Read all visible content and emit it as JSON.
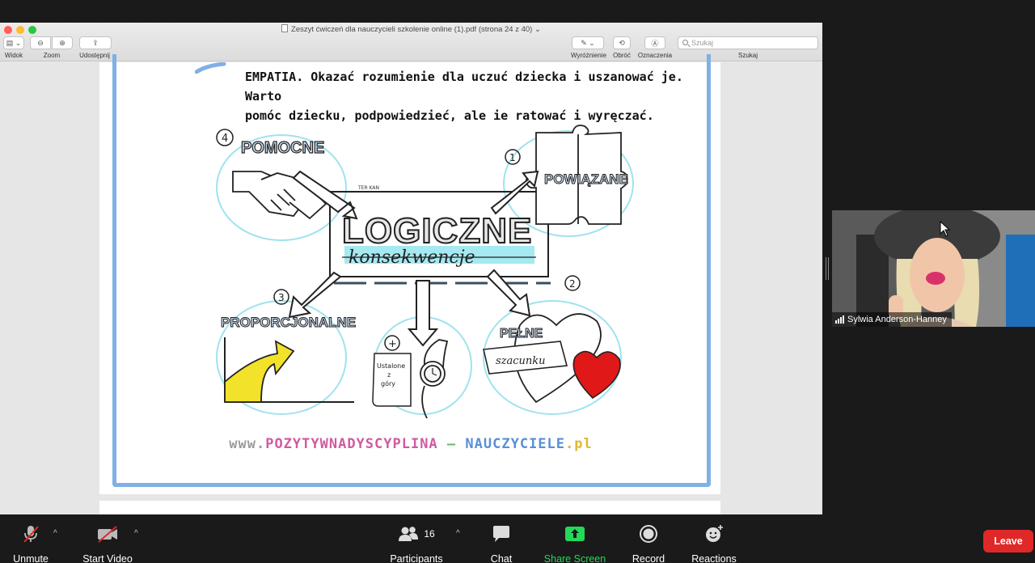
{
  "window": {
    "document_title": "Zeszyt ćwiczeń dla nauczycieli szkolenie online (1).pdf (strona 24 z 40)",
    "toolbar": {
      "view_label": "Widok",
      "zoom_label": "Zoom",
      "share_label": "Udostępnij",
      "highlight_label": "Wyróżnienie",
      "rotate_label": "Obróć",
      "markup_label": "Oznaczenia",
      "search_placeholder": "Szukaj",
      "search_label": "Szukaj"
    }
  },
  "document": {
    "text_line1": "EMPATIA. Okazać rozumienie dla uczuć dziecka i uszanować je. Warto",
    "text_line2": "pomóc dziecku, podpowiedzieć, ale ie ratować i wyręczać.",
    "illustration": {
      "center_title": "LOGICZNE",
      "center_subtitle": "konsekwencje",
      "signature": "TER KAN",
      "item1_number": "1",
      "item1_label": "POWIĄZANE",
      "item2_number": "2",
      "item2_label": "PEŁNE",
      "item2_banner": "szacunku",
      "item3_number": "3",
      "item3_label": "PROPORCJONALNE",
      "item4_number": "4",
      "item4_label": "POMOCNE",
      "plus_sign": "+",
      "scroll_text_1": "Ustalone",
      "scroll_text_2": "z",
      "scroll_text_3": "góry"
    },
    "footer_url_prefix": "www.",
    "footer_url_part1": "POZYTYWNADYSCYPLINA",
    "footer_url_dash": "–",
    "footer_url_part2": "NAUCZYCIELE",
    "footer_url_suffix": ".pl"
  },
  "participant": {
    "name": "Sylwia Anderson-Hanney"
  },
  "controls": {
    "unmute": "Unmute",
    "start_video": "Start Video",
    "participants": "Participants",
    "participants_count": "16",
    "chat": "Chat",
    "share_screen": "Share Screen",
    "record": "Record",
    "reactions": "Reactions",
    "leave": "Leave"
  },
  "colors": {
    "share_green": "#23d959",
    "leave_red": "#e02828",
    "frame_blue": "#7fb0e6",
    "accent_cyan": "#6fd8e6"
  }
}
